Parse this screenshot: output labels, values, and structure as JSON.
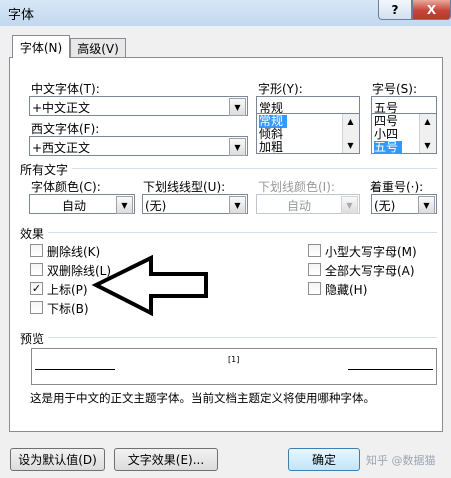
{
  "window": {
    "title": "字体",
    "help": "?",
    "close": "X"
  },
  "tabs": [
    {
      "label": "字体(N)"
    },
    {
      "label": "高级(V)"
    }
  ],
  "font": {
    "chinese_label": "中文字体(T):",
    "chinese_value": "+中文正文",
    "western_label": "西文字体(F):",
    "western_value": "+西文正文",
    "style_label": "字形(Y):",
    "style_value": "常规",
    "style_options": [
      "常规",
      "倾斜",
      "加粗"
    ],
    "size_label": "字号(S):",
    "size_value": "五号",
    "size_options": [
      "四号",
      "小四",
      "五号"
    ]
  },
  "all_text": {
    "section_label": "所有文字",
    "color_label": "字体颜色(C):",
    "color_value": "自动",
    "underline_style_label": "下划线线型(U):",
    "underline_style_value": "(无)",
    "underline_color_label": "下划线颜色(I):",
    "underline_color_value": "自动",
    "emphasis_label": "着重号(·):",
    "emphasis_value": "(无)"
  },
  "effects": {
    "section_label": "效果",
    "items": [
      {
        "label": "删除线(K)",
        "checked": false,
        "mark": ""
      },
      {
        "label": "双删除线(L)",
        "checked": false,
        "mark": ""
      },
      {
        "label": "上标(P)",
        "checked": true,
        "mark": "✓"
      },
      {
        "label": "下标(B)",
        "checked": false,
        "mark": ""
      },
      {
        "label": "小型大写字母(M)",
        "checked": false,
        "mark": ""
      },
      {
        "label": "全部大写字母(A)",
        "checked": false,
        "mark": ""
      },
      {
        "label": "隐藏(H)",
        "checked": false,
        "mark": ""
      }
    ]
  },
  "preview": {
    "section_label": "预览",
    "sample": "[1]",
    "description": "这是用于中文的正文主题字体。当前文档主题定义将使用哪种字体。"
  },
  "footer": {
    "set_default": "设为默认值(D)",
    "text_effects": "文字效果(E)...",
    "ok": "确定",
    "watermark": "知乎 @数据猫"
  },
  "colors": {
    "selection": "#3399ff",
    "arrow": "#000000"
  }
}
